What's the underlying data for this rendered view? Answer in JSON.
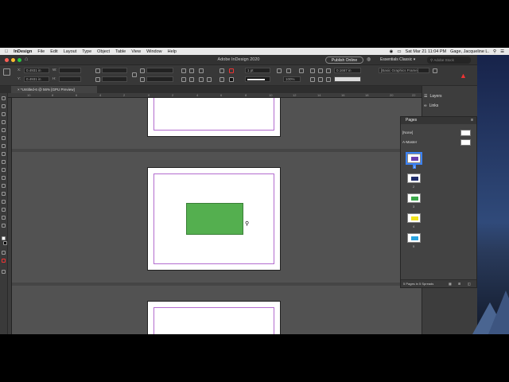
{
  "menubar": {
    "app_name": "InDesign",
    "items": [
      "File",
      "Edit",
      "Layout",
      "Type",
      "Object",
      "Table",
      "View",
      "Window",
      "Help"
    ],
    "clock": "Sat Mar 21 11:04 PM",
    "user": "Gage, Jacqueline L."
  },
  "appbar": {
    "title": "Adobe InDesign 2020",
    "publish_label": "Publish Online",
    "workspace": "Essentials Classic",
    "search_placeholder": "Adobe Stock"
  },
  "control": {
    "x_value": "0.4931 in",
    "y_value": "0.4931 in",
    "stroke_weight": "1 pt",
    "zoom": "100%",
    "spacing": "0.1667 in",
    "object_style": "[Basic Graphics Frame]"
  },
  "document_tab": {
    "label": "*Untitled-6 @ 56% [GPU Preview]"
  },
  "ruler": {
    "ticks": [
      "10",
      "8",
      "6",
      "4",
      "2",
      "0",
      "2",
      "4",
      "6",
      "8",
      "10",
      "12",
      "14",
      "16",
      "18",
      "20",
      "22"
    ]
  },
  "dock": {
    "layers_label": "Layers",
    "links_label": "Links"
  },
  "pages_panel": {
    "title": "Pages",
    "none_label": "[None]",
    "master_label": "A-Master",
    "pages": [
      {
        "number": "1",
        "color": "#6a3fb0"
      },
      {
        "number": "2",
        "color": "#1f2d6b"
      },
      {
        "number": "3",
        "color": "#3aa84a"
      },
      {
        "number": "4",
        "color": "#f0e21a"
      },
      {
        "number": "5",
        "color": "#29a3e0"
      }
    ],
    "footer": "5 Pages in 5 Spreads"
  },
  "colors": {
    "accent_frame": "#54af4f",
    "margin_guide": "#b36ccf",
    "pasteboard": "#525252"
  }
}
